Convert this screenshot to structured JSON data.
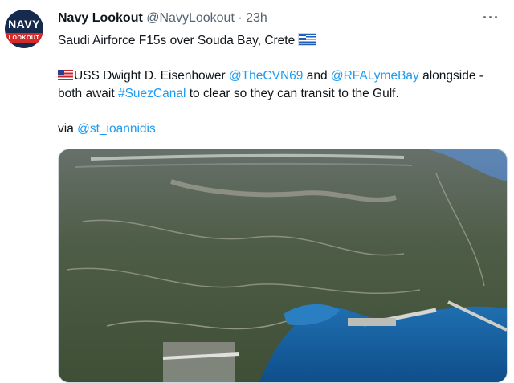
{
  "tweet": {
    "avatar": {
      "top_text": "NAVY",
      "band_text": "LOOKOUT"
    },
    "author_name": "Navy Lookout",
    "author_handle": "@NavyLookout",
    "separator": "·",
    "timestamp": "23h",
    "more_label": "···",
    "line1": "Saudi Airforce F15s over Souda Bay, Crete",
    "line1_flag": "greece-flag-icon",
    "line2": {
      "flag": "us-flag-icon",
      "t1": "USS Dwight D. Eisenhower ",
      "m1": "@TheCVN69",
      "t2": " and ",
      "m2": "@RFALymeBay",
      "t3": " alongside -"
    },
    "line3": {
      "t1": "both await ",
      "h1": "#SuezCanal",
      "t2": " to clear so they can transit to the Gulf."
    },
    "line4": {
      "t1": "via ",
      "m1": "@st_ioannidis"
    },
    "media": {
      "type": "photo",
      "icon": "aerial-photo-souda-bay"
    },
    "colors": {
      "link": "#1d9bf0",
      "text": "#0f1419",
      "secondary": "#536471"
    }
  }
}
